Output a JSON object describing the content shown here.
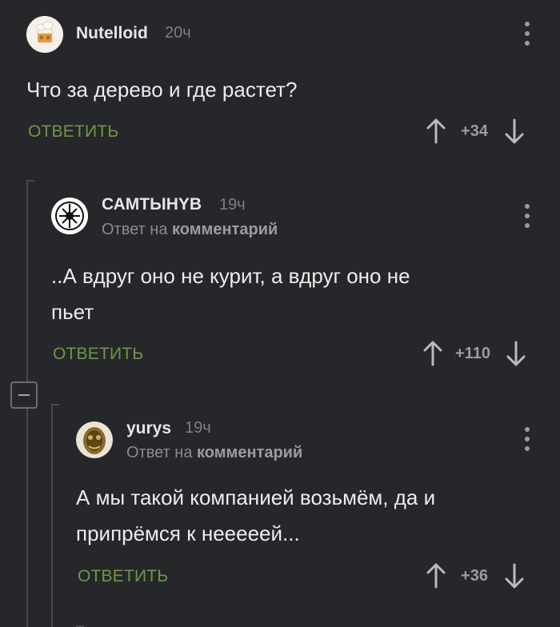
{
  "comments": [
    {
      "author": "Nutelloid",
      "time": "20ч",
      "text": "Что за дерево и где растет?",
      "reply_label": "ОТВЕТИТЬ",
      "score": "+34"
    },
    {
      "author": "САМТЫНYВ",
      "time": "19ч",
      "reply_to_prefix": "Ответ на",
      "reply_to_target": "комментарий",
      "text_line1": "..А вдруг оно не курит, а вдруг оно не",
      "text_line2": "пьет",
      "reply_label": "ОТВЕТИТЬ",
      "score": "+110"
    },
    {
      "author": "yurys",
      "time": "19ч",
      "reply_to_prefix": "Ответ на",
      "reply_to_target": "комментарий",
      "text_line1": "А мы такой компанией возьмём, да и",
      "text_line2": "припрёмся к нееееей...",
      "reply_label": "ОТВЕТИТЬ",
      "score": "+36"
    }
  ],
  "colors": {
    "background": "#25272b",
    "reply_accent": "#6d9a3c",
    "muted": "#7d7f84"
  }
}
